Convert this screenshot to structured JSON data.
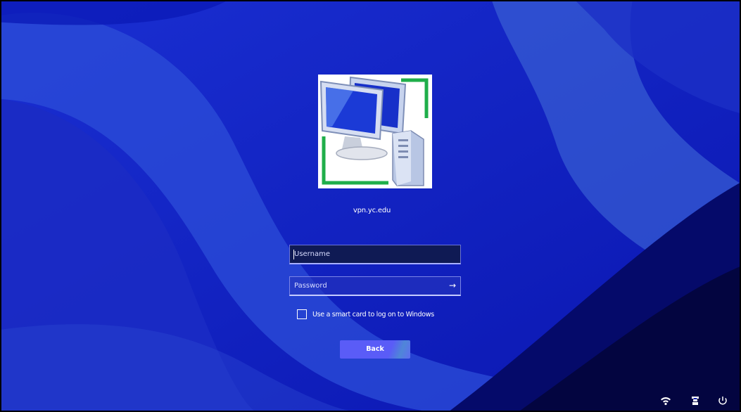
{
  "server": {
    "name": "vpn.yc.edu"
  },
  "login": {
    "username_placeholder": "Username",
    "username_value": "",
    "password_placeholder": "Password",
    "password_value": "",
    "submit_icon": "arrow-right-icon",
    "smartcard_label": "Use a smart card to log on to Windows",
    "smartcard_checked": false,
    "back_label": "Back"
  },
  "tray": {
    "icons": [
      "network-icon",
      "accessibility-icon",
      "power-icon"
    ]
  },
  "colors": {
    "background": "#0a18b4",
    "button": "#5a5cf7",
    "field_focus": "#0f1a54",
    "tile": "#ffffff",
    "tile_accent": "#1fae4a"
  }
}
